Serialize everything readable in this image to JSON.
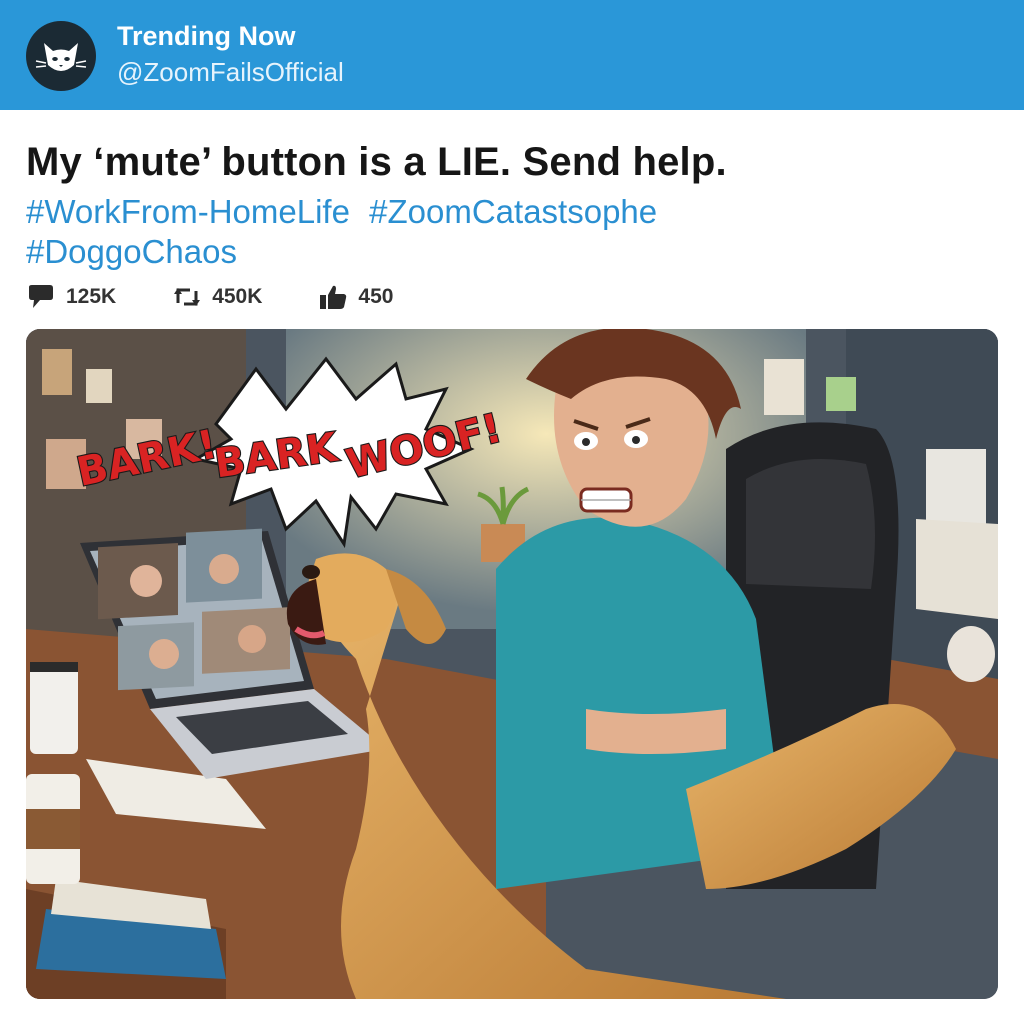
{
  "header": {
    "title": "Trending Now",
    "handle": "@ZoomFailsOfficial",
    "avatar_icon": "cat-face-icon",
    "background_color": "#2a97d8"
  },
  "post": {
    "text": "My ‘mute’ button is a LIE. Send help.",
    "hashtags": [
      "#WorkFrom-HomeLife",
      "#ZoomCatastsophe",
      "#DoggoChaos"
    ],
    "hashtag_color": "#2a8fd1"
  },
  "stats": {
    "replies": {
      "icon": "speech-bubble-icon",
      "value": "125K"
    },
    "retweets": {
      "icon": "retweet-icon",
      "value": "450K"
    },
    "likes": {
      "icon": "thumbs-up-icon",
      "value": "450"
    }
  },
  "media": {
    "speech_bubble": {
      "words": [
        "BARK!",
        "BARK",
        "WOOF!"
      ]
    }
  }
}
